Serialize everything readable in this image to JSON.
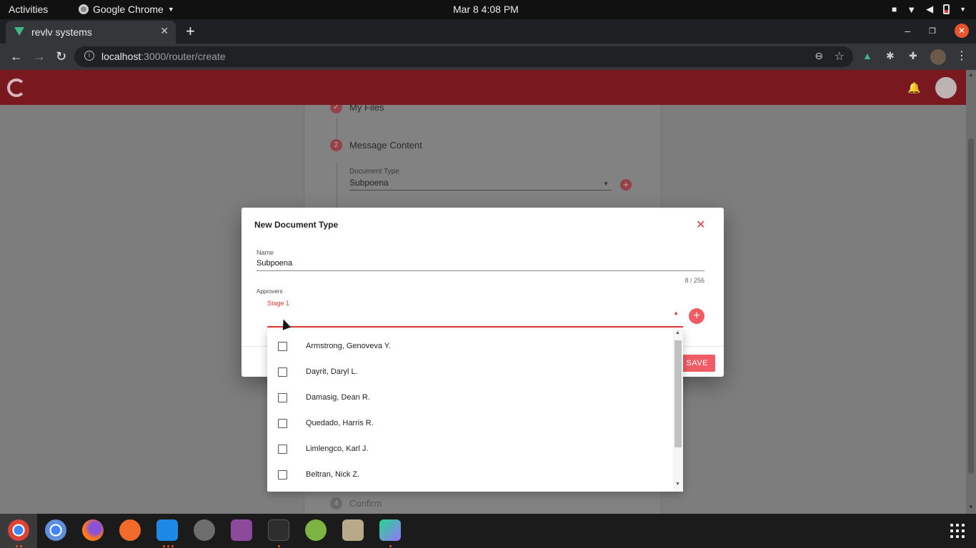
{
  "system": {
    "activities": "Activities",
    "app_name": "Google Chrome",
    "clock": "Mar 8   4:08 PM"
  },
  "browser": {
    "tab_title": "revlv systems",
    "url_host": "localhost",
    "url_rest": ":3000/router/create"
  },
  "app": {
    "steps": [
      {
        "num": "",
        "label": "My Files"
      },
      {
        "num": "2",
        "label": "Message Content"
      },
      {
        "num": "4",
        "label": "Confirm"
      }
    ],
    "document_type_label": "Document Type",
    "document_type_value": "Subpoena"
  },
  "dialog": {
    "title": "New Document Type",
    "name_label": "Name",
    "name_value": "Subpoena",
    "counter": "8 / 256",
    "approvers_label": "Approvers",
    "stage_label": "Stage 1",
    "save_label": "SAVE"
  },
  "dropdown": {
    "options": [
      "Armstrong, Genoveva Y.",
      "Dayrit, Daryl L.",
      "Damasig, Dean R.",
      "Quedado, Harris R.",
      "Limlengco, Karl J.",
      "Beltran, Nick Z."
    ]
  },
  "colors": {
    "appbar": "#7a1820",
    "accent": "#e53935",
    "button": "#ef5c66"
  }
}
